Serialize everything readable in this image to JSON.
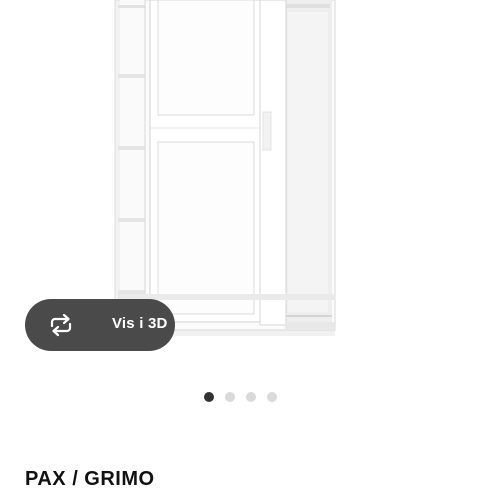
{
  "view_3d": {
    "label": "Vis i 3D",
    "icon": "rotate-3d-icon"
  },
  "carousel": {
    "total": 4,
    "active_index": 0
  },
  "product": {
    "title": "PAX / GRIMO"
  },
  "colors": {
    "button_bg": "#4a4a4a",
    "dot_active": "#333333",
    "dot_inactive": "#d9d9d9"
  }
}
